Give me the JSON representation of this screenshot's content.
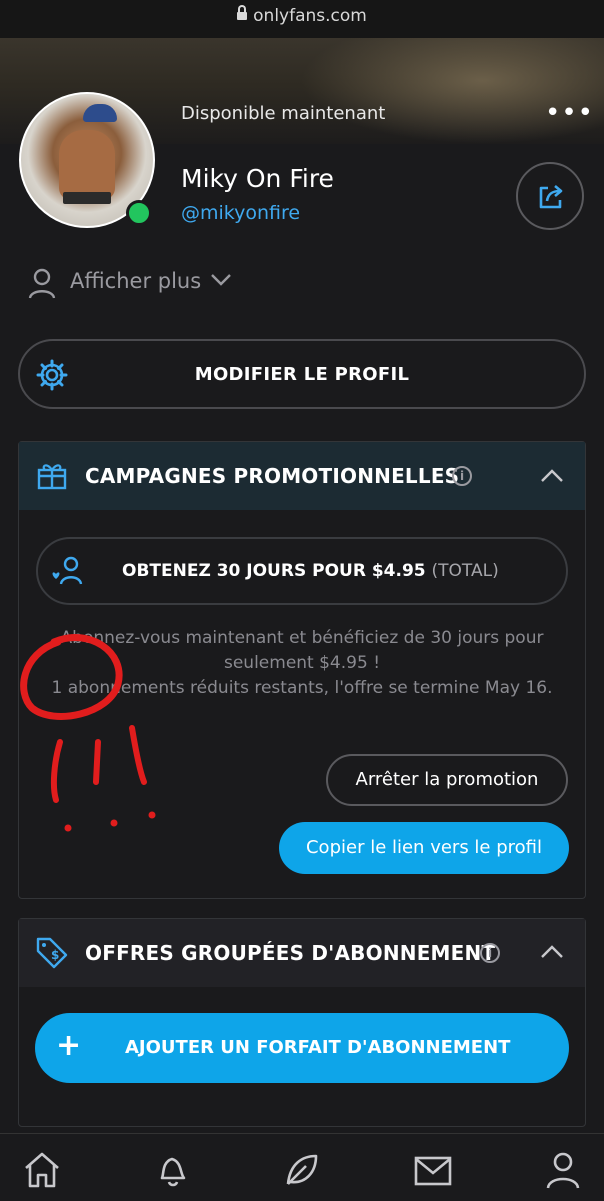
{
  "browser": {
    "url": "onlyfans.com"
  },
  "header": {
    "availability": "Disponible maintenant",
    "profile_name": "Miky On Fire",
    "handle": "@mikyonfire"
  },
  "show_more": {
    "label": "Afficher plus"
  },
  "edit_profile": {
    "label": "MODIFIER LE PROFIL"
  },
  "promotions": {
    "title": "CAMPAGNES PROMOTIONNELLES",
    "offer_main": "OBTENEZ 30 JOURS POUR $4.95",
    "offer_suffix": "(TOTAL)",
    "description_line1": "Abonnez-vous maintenant et bénéficiez de 30 jours pour seulement $4.95 !",
    "description_line2": "1 abonnements réduits restants, l'offre se termine May 16.",
    "stop_label": "Arrêter la promotion",
    "copy_label": "Copier le lien vers le profil"
  },
  "bundles": {
    "title": "OFFRES GROUPÉES D'ABONNEMENT",
    "add_label": "AJOUTER UN FORFAIT D'ABONNEMENT"
  },
  "colors": {
    "accent": "#0ea5e9",
    "link": "#3fa9ef",
    "online": "#22c55e",
    "annotation": "#e11d1d"
  },
  "icons": [
    "lock-icon",
    "more-icon",
    "share-icon",
    "user-icon",
    "chevron-down-icon",
    "gear-icon",
    "gift-icon",
    "info-icon",
    "chevron-up-icon",
    "user-heart-icon",
    "tag-dollar-icon",
    "plus-icon",
    "home-icon",
    "bell-icon",
    "leaf-icon",
    "mail-icon",
    "profile-icon"
  ]
}
